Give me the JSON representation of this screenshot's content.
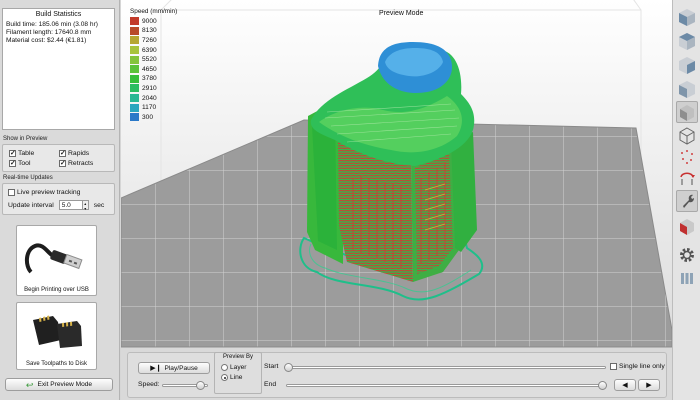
{
  "stats": {
    "title": "Build Statistics",
    "lines": [
      "Build time: 185.06 min (3.08 hr)",
      "Filament length: 17640.8 mm",
      "Material cost: $2.44 (€1.81)"
    ]
  },
  "show_in_preview": {
    "label": "Show in Preview",
    "items": [
      {
        "label": "Table",
        "checked": true
      },
      {
        "label": "Rapids",
        "checked": true
      },
      {
        "label": "Tool",
        "checked": true
      },
      {
        "label": "Retracts",
        "checked": true
      }
    ]
  },
  "realtime": {
    "label": "Real-time Updates",
    "live_label": "Live preview tracking",
    "live_checked": false,
    "interval_label": "Update interval",
    "interval_value": "5.0",
    "interval_unit": "sec"
  },
  "usb": {
    "caption": "Begin Printing over USB"
  },
  "disk": {
    "caption": "Save Toolpaths to Disk"
  },
  "exit_button": "Exit Preview Mode",
  "viewport": {
    "mode": "Preview Mode",
    "legend_title": "Speed (mm/min)",
    "legend": [
      {
        "value": "9000",
        "color": "#c23a2a"
      },
      {
        "value": "8130",
        "color": "#b84a2a"
      },
      {
        "value": "7260",
        "color": "#b6a732"
      },
      {
        "value": "6390",
        "color": "#a8c43c"
      },
      {
        "value": "5520",
        "color": "#84c43c"
      },
      {
        "value": "4650",
        "color": "#5bc23a"
      },
      {
        "value": "3780",
        "color": "#36be3a"
      },
      {
        "value": "2910",
        "color": "#2bbd62"
      },
      {
        "value": "2040",
        "color": "#2ab894"
      },
      {
        "value": "1170",
        "color": "#2aa6be"
      },
      {
        "value": "300",
        "color": "#2a78c8"
      }
    ]
  },
  "controls": {
    "play_pause": "Play/Pause",
    "speed_label": "Speed:",
    "preview_by_label": "Preview By",
    "preview_options": [
      {
        "label": "Layer",
        "selected": false
      },
      {
        "label": "Line",
        "selected": true
      }
    ],
    "start_label": "Start",
    "end_label": "End",
    "single_line_label": "Single line only",
    "single_line_checked": false
  },
  "toolbar_icons": [
    "view-cube-front-icon",
    "view-cube-top-icon",
    "view-cube-side-icon",
    "view-cube-iso-icon",
    "cube-wire-icon",
    "wire-cube-icon",
    "points-icon",
    "rotate-icon",
    "wrench-icon",
    "cube-red-icon",
    "gear-icon",
    "layers-icon"
  ]
}
